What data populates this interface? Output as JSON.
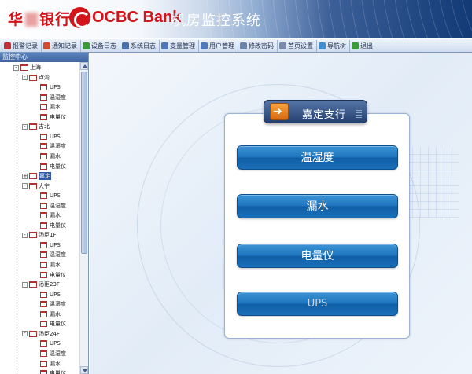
{
  "header": {
    "brand_cn_left": "华",
    "brand_cn_right": "银行",
    "brand_ocbc": "OCBC Bank",
    "app_title": "机房监控系统"
  },
  "toolbar": {
    "items": [
      {
        "label": "报警记录",
        "icon": "alarm-icon",
        "color": "#c2303a"
      },
      {
        "label": "通知记录",
        "icon": "notice-icon",
        "color": "#d44b2b"
      },
      {
        "label": "设备日志",
        "icon": "device-log-icon",
        "color": "#3d9a3a"
      },
      {
        "label": "系统日志",
        "icon": "system-log-icon",
        "color": "#4a6fae"
      },
      {
        "label": "变量管理",
        "icon": "variable-icon",
        "color": "#4f79b8"
      },
      {
        "label": "用户管理",
        "icon": "user-icon",
        "color": "#4f79b8"
      },
      {
        "label": "修改密码",
        "icon": "password-icon",
        "color": "#6a84ad"
      },
      {
        "label": "首页设置",
        "icon": "tools-icon",
        "color": "#7a8aa8"
      },
      {
        "label": "导航树",
        "icon": "nav-tree-icon",
        "color": "#3f8fd0"
      },
      {
        "label": "退出",
        "icon": "exit-icon",
        "color": "#3d9a3a"
      }
    ]
  },
  "sidebar": {
    "title": "监控中心",
    "root": "上海",
    "groups": [
      {
        "label": "卢湾",
        "children": [
          "UPS",
          "温湿度",
          "漏水",
          "电量仪"
        ]
      },
      {
        "label": "古北",
        "children": [
          "UPS",
          "温湿度",
          "漏水",
          "电量仪"
        ]
      },
      {
        "label": "嘉定",
        "children": [],
        "selected": true
      },
      {
        "label": "大宁",
        "children": [
          "UPS",
          "温湿度",
          "漏水",
          "电量仪"
        ]
      },
      {
        "label": "汤臣1F",
        "children": [
          "UPS",
          "温湿度",
          "漏水",
          "电量仪"
        ]
      },
      {
        "label": "汤臣23F",
        "children": [
          "UPS",
          "温湿度",
          "漏水",
          "电量仪"
        ]
      },
      {
        "label": "汤臣24F",
        "children": [
          "UPS",
          "温湿度",
          "漏水",
          "电量仪"
        ]
      }
    ]
  },
  "main": {
    "panel_title": "嘉定支行",
    "buttons": [
      "温湿度",
      "漏水",
      "电量仪",
      "UPS"
    ]
  },
  "colors": {
    "brand_red": "#d4141b",
    "header_blue": "#123a75",
    "button_blue": "#1d74bd",
    "selected_node": "#2f59a8"
  }
}
